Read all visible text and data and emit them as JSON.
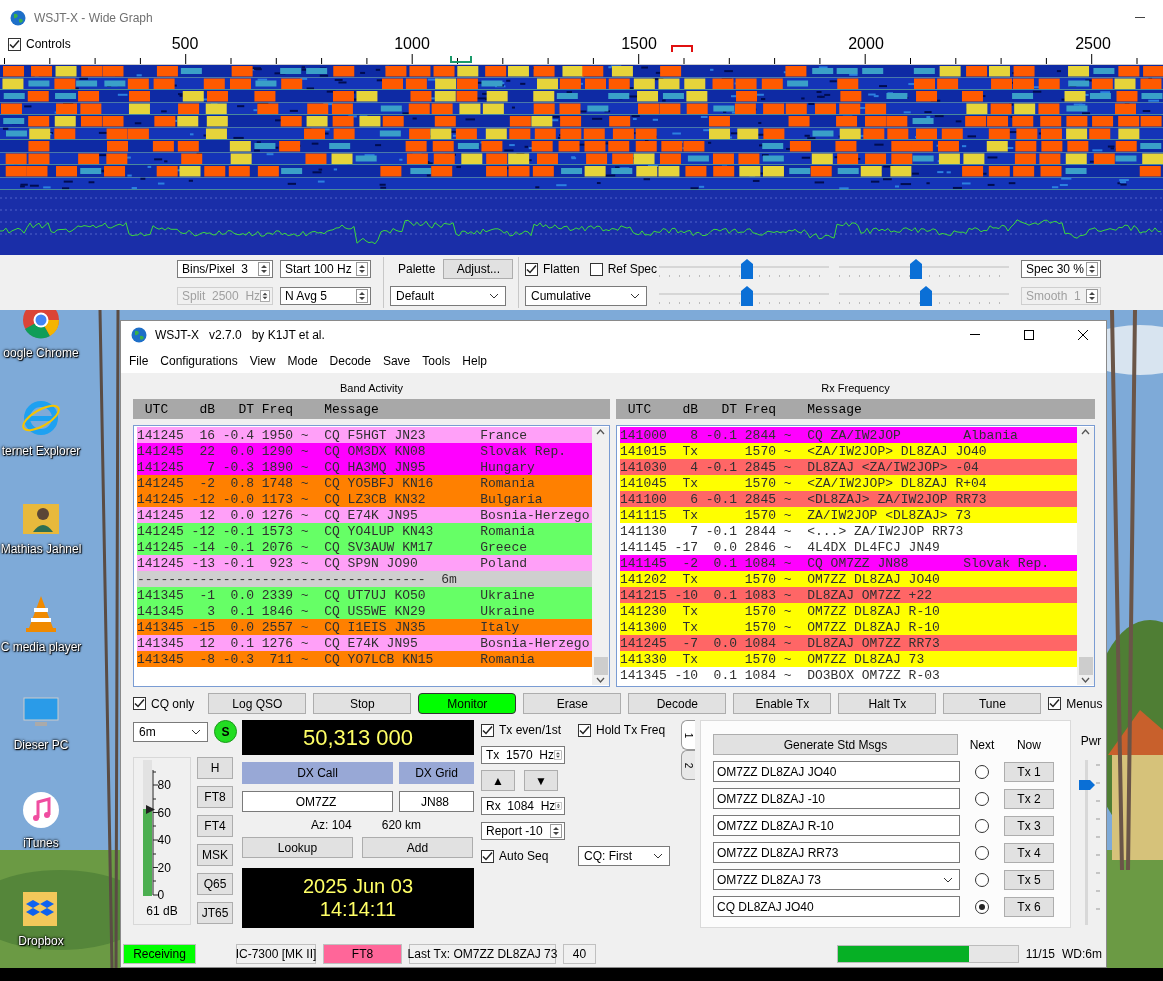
{
  "wide_graph": {
    "title": "WSJT-X - Wide Graph",
    "controls_toggle": {
      "label": "Controls",
      "checked": true
    },
    "ruler_labels": [
      "500",
      "1000",
      "1500",
      "2000",
      "2500"
    ],
    "spin_left": [
      {
        "text": "Bins/Pixel  3",
        "disabled": false
      },
      {
        "text": "Start 100 Hz",
        "disabled": false
      },
      {
        "text": "Split  2500  Hz",
        "disabled": true
      },
      {
        "text": "N Avg 5",
        "disabled": false
      }
    ],
    "palette_label": "Palette",
    "adjust_button": "Adjust...",
    "palette_select": "Default",
    "flatten": {
      "label": "Flatten",
      "checked": true
    },
    "ref_spec": {
      "label": "Ref Spec",
      "checked": false
    },
    "spectrum_select": "Cumulative",
    "sliders": [
      {
        "level": 0.52
      },
      {
        "level": 0.45
      },
      {
        "level": 0.52
      },
      {
        "level": 0.51
      }
    ],
    "spin_right": [
      {
        "text": "Spec 30 %",
        "disabled": false
      },
      {
        "text": "Smooth  1",
        "disabled": true
      }
    ]
  },
  "desktop_icons": [
    {
      "label": "oogle Chrome",
      "kind": "chrome"
    },
    {
      "label": "ternet Explorer",
      "kind": "browser"
    },
    {
      "label": "Mathias Jahnel",
      "kind": "user"
    },
    {
      "label": "C media player",
      "kind": "cone"
    },
    {
      "label": "Dieser PC",
      "kind": "computer"
    },
    {
      "label": "iTunes",
      "kind": "music"
    },
    {
      "label": "Dropbox",
      "kind": "box"
    }
  ],
  "main": {
    "title": "WSJT-X   v2.7.0   by K1JT et al.",
    "menu": [
      "File",
      "Configurations",
      "View",
      "Mode",
      "Decode",
      "Save",
      "Tools",
      "Help"
    ],
    "panels": [
      {
        "title": "Band Activity",
        "columns": [
          "UTC",
          "dB",
          "DT",
          "Freq",
          "Message"
        ],
        "rows": [
          {
            "kind": "decode",
            "utc": "141245",
            "db": "16",
            "dt": "-0.4",
            "freq": "1950",
            "mark": "~",
            "message": "CQ F5HGT JN23",
            "country": "France",
            "color": "#ffa0f8"
          },
          {
            "kind": "decode",
            "utc": "141245",
            "db": "22",
            "dt": "0.0",
            "freq": "1290",
            "mark": "~",
            "message": "CQ OM3DX KN08",
            "country": "Slovak Rep.",
            "color": "#ff00ff"
          },
          {
            "kind": "decode",
            "utc": "141245",
            "db": "7",
            "dt": "-0.3",
            "freq": "1890",
            "mark": "~",
            "message": "CQ HA3MQ JN95",
            "country": "Hungary",
            "color": "#ff00ff"
          },
          {
            "kind": "decode",
            "utc": "141245",
            "db": "-2",
            "dt": "0.8",
            "freq": "1748",
            "mark": "~",
            "message": "CQ YO5BFJ KN16",
            "country": "Romania",
            "color": "#ff8000"
          },
          {
            "kind": "decode",
            "utc": "141245",
            "db": "-12",
            "dt": "-0.0",
            "freq": "1173",
            "mark": "~",
            "message": "CQ LZ3CB KN32",
            "country": "Bulgaria",
            "color": "#ff8000"
          },
          {
            "kind": "decode",
            "utc": "141245",
            "db": "12",
            "dt": "0.0",
            "freq": "1276",
            "mark": "~",
            "message": "CQ E74K JN95",
            "country": "Bosnia-Herzego",
            "color": "#ffa0f8"
          },
          {
            "kind": "decode",
            "utc": "141245",
            "db": "-12",
            "dt": "-0.1",
            "freq": "1573",
            "mark": "~",
            "message": "CQ YO4LUP KN43",
            "country": "Romania",
            "color": "#66ff66"
          },
          {
            "kind": "decode",
            "utc": "141245",
            "db": "-14",
            "dt": "-0.1",
            "freq": "2076",
            "mark": "~",
            "message": "CQ SV3AUW KM17",
            "country": "Greece",
            "color": "#66ff66"
          },
          {
            "kind": "decode",
            "utc": "141245",
            "db": "-13",
            "dt": "-0.1",
            "freq": "923",
            "mark": "~",
            "message": "CQ SP9N JO90",
            "country": "Poland",
            "color": "#ffa0f8"
          },
          {
            "kind": "divider",
            "text": "-------------------------------------  6m"
          },
          {
            "kind": "decode",
            "utc": "141345",
            "db": "-1",
            "dt": "0.0",
            "freq": "2339",
            "mark": "~",
            "message": "CQ UT7UJ KO50",
            "country": "Ukraine",
            "color": "#66ff66"
          },
          {
            "kind": "decode",
            "utc": "141345",
            "db": "3",
            "dt": "0.1",
            "freq": "1846",
            "mark": "~",
            "message": "CQ US5WE KN29",
            "country": "Ukraine",
            "color": "#66ff66"
          },
          {
            "kind": "decode",
            "utc": "141345",
            "db": "-15",
            "dt": "0.0",
            "freq": "2557",
            "mark": "~",
            "message": "CQ I1EIS JN35",
            "country": "Italy",
            "color": "#ff8000"
          },
          {
            "kind": "decode",
            "utc": "141345",
            "db": "12",
            "dt": "0.1",
            "freq": "1276",
            "mark": "~",
            "message": "CQ E74K JN95",
            "country": "Bosnia-Herzego",
            "color": "#ffa0f8"
          },
          {
            "kind": "decode",
            "utc": "141345",
            "db": "-8",
            "dt": "-0.3",
            "freq": "711",
            "mark": "~",
            "message": "CQ YO7LCB KN15",
            "country": "Romania",
            "color": "#ff8000"
          }
        ]
      },
      {
        "title": "Rx Frequency",
        "columns": [
          "UTC",
          "dB",
          "DT",
          "Freq",
          "Message"
        ],
        "rows": [
          {
            "kind": "decode",
            "utc": "141000",
            "db": "8",
            "dt": "-0.1",
            "freq": "2844",
            "mark": "~",
            "message": "CQ ZA/IW2JOP",
            "country": "Albania",
            "color": "#ff00ff"
          },
          {
            "kind": "decode",
            "utc": "141015",
            "db": "Tx",
            "freq": "1570",
            "mark": "~",
            "message": "<ZA/IW2JOP> DL8ZAJ JO40",
            "color": "#ffff00"
          },
          {
            "kind": "decode",
            "utc": "141030",
            "db": "4",
            "dt": "-0.1",
            "freq": "2845",
            "mark": "~",
            "message": "DL8ZAJ <ZA/IW2JOP> -04",
            "color": "#ff6666"
          },
          {
            "kind": "decode",
            "utc": "141045",
            "db": "Tx",
            "freq": "1570",
            "mark": "~",
            "message": "<ZA/IW2JOP> DL8ZAJ R+04",
            "color": "#ffff00"
          },
          {
            "kind": "decode",
            "utc": "141100",
            "db": "6",
            "dt": "-0.1",
            "freq": "2845",
            "mark": "~",
            "message": "<DL8ZAJ> ZA/IW2JOP RR73",
            "color": "#ff6666"
          },
          {
            "kind": "decode",
            "utc": "141115",
            "db": "Tx",
            "freq": "1570",
            "mark": "~",
            "message": "ZA/IW2JOP <DL8ZAJ> 73",
            "color": "#ffff00"
          },
          {
            "kind": "decode",
            "utc": "141130",
            "db": "7",
            "dt": "-0.1",
            "freq": "2844",
            "mark": "~",
            "message": "<...> ZA/IW2JOP RR73",
            "color": "#ffffff"
          },
          {
            "kind": "decode",
            "utc": "141145",
            "db": "-17",
            "dt": "0.0",
            "freq": "2846",
            "mark": "~",
            "message": "4L4DX DL4FCJ JN49",
            "color": "#ffffff"
          },
          {
            "kind": "decode",
            "utc": "141145",
            "db": "-2",
            "dt": "0.1",
            "freq": "1084",
            "mark": "~",
            "message": "CQ OM7ZZ JN88",
            "country": "Slovak Rep.",
            "color": "#ff00ff"
          },
          {
            "kind": "decode",
            "utc": "141202",
            "db": "Tx",
            "freq": "1570",
            "mark": "~",
            "message": "OM7ZZ DL8ZAJ JO40",
            "color": "#ffff00"
          },
          {
            "kind": "decode",
            "utc": "141215",
            "db": "-10",
            "dt": "0.1",
            "freq": "1083",
            "mark": "~",
            "message": "DL8ZAJ OM7ZZ +22",
            "color": "#ff6666"
          },
          {
            "kind": "decode",
            "utc": "141230",
            "db": "Tx",
            "freq": "1570",
            "mark": "~",
            "message": "OM7ZZ DL8ZAJ R-10",
            "color": "#ffff00"
          },
          {
            "kind": "decode",
            "utc": "141300",
            "db": "Tx",
            "freq": "1570",
            "mark": "~",
            "message": "OM7ZZ DL8ZAJ R-10",
            "color": "#ffff00"
          },
          {
            "kind": "decode",
            "utc": "141245",
            "db": "-7",
            "dt": "0.0",
            "freq": "1084",
            "mark": "~",
            "message": "DL8ZAJ OM7ZZ RR73",
            "color": "#ff6666"
          },
          {
            "kind": "decode",
            "utc": "141330",
            "db": "Tx",
            "freq": "1570",
            "mark": "~",
            "message": "OM7ZZ DL8ZAJ 73",
            "color": "#ffff00"
          },
          {
            "kind": "decode",
            "utc": "141345",
            "db": "-10",
            "dt": "0.1",
            "freq": "1084",
            "mark": "~",
            "message": "DO3BOX OM7ZZ R-03",
            "color": "#ffffff"
          }
        ]
      }
    ],
    "cq_only": {
      "label": "CQ only",
      "checked": true
    },
    "buttons": [
      {
        "label": "Log QSO",
        "active": false
      },
      {
        "label": "Stop",
        "active": false
      },
      {
        "label": "Monitor",
        "active": true
      },
      {
        "label": "Erase",
        "active": false
      },
      {
        "label": "Decode",
        "active": false
      },
      {
        "label": "Enable Tx",
        "active": false
      },
      {
        "label": "Halt Tx",
        "active": false
      },
      {
        "label": "Tune",
        "active": false
      }
    ],
    "menus": {
      "label": "Menus",
      "checked": true
    },
    "band": "6m",
    "s_badge": "S",
    "meter": {
      "scale": [
        "80",
        "60",
        "40",
        "20",
        "0"
      ],
      "level": 0.64,
      "reading": "61 dB"
    },
    "modes": [
      "H",
      "FT8",
      "FT4",
      "MSK",
      "Q65",
      "JT65"
    ],
    "dial": "50,313 000",
    "dx_call_label": "DX Call",
    "dx_grid_label": "DX Grid",
    "dx_call": "OM7ZZ",
    "dx_grid": "JN88",
    "azimuth": "Az: 104",
    "distance": "620 km",
    "lookup": "Lookup",
    "add": "Add",
    "date": "2025 Jun 03",
    "time": "14:14:11",
    "tx_even": {
      "label": "Tx even/1st",
      "checked": true
    },
    "hold_tx": {
      "label": "Hold Tx Freq",
      "checked": true
    },
    "tx_freq": "Tx  1570  Hz",
    "up": "▲",
    "down": "▼",
    "rx_freq": "Rx  1084  Hz",
    "report": "Report -10",
    "auto_seq": {
      "label": "Auto Seq",
      "checked": true
    },
    "cq_select": "CQ: First",
    "tabs": [
      {
        "label": "1",
        "selected": true
      },
      {
        "label": "2",
        "selected": false
      }
    ],
    "messages": {
      "generate": "Generate Std Msgs",
      "next_header": "Next",
      "now_header": "Now",
      "rows": [
        {
          "kind": "field",
          "text": "OM7ZZ DL8ZAJ JO40",
          "selected": false,
          "button": "Tx 1"
        },
        {
          "kind": "field",
          "text": "OM7ZZ DL8ZAJ -10",
          "selected": false,
          "button": "Tx 2"
        },
        {
          "kind": "field",
          "text": "OM7ZZ DL8ZAJ R-10",
          "selected": false,
          "button": "Tx 3"
        },
        {
          "kind": "field",
          "text": "OM7ZZ DL8ZAJ RR73",
          "selected": false,
          "button": "Tx 4"
        },
        {
          "kind": "combo",
          "text": "OM7ZZ DL8ZAJ 73",
          "selected": false,
          "button": "Tx 5"
        },
        {
          "kind": "field",
          "text": "CQ DL8ZAJ JO40",
          "selected": true,
          "button": "Tx 6"
        }
      ]
    },
    "power": {
      "label": "Pwr",
      "level": 0.85
    },
    "status": {
      "state": "Receiving",
      "rig": "IC-7300 [MK II]",
      "mode": "FT8",
      "last_tx": "Last Tx: OM7ZZ DL8ZAJ 73",
      "count": "40",
      "level": 0.73,
      "period": "11/15",
      "wd": "WD:6m"
    }
  }
}
